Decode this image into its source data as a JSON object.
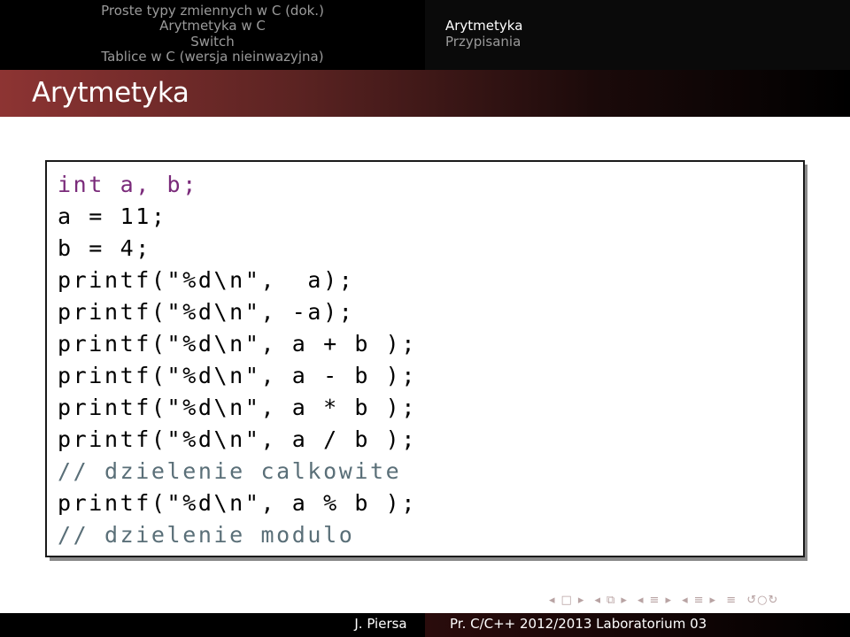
{
  "nav": {
    "left": {
      "section": "Proste typy zmiennych w C (dok.)",
      "subsections": [
        "Arytmetyka w C",
        "Switch",
        "Tablice w C (wersja nieinwazyjna)"
      ]
    },
    "right": {
      "section": "Arytmetyka",
      "subsections": [
        "Przypisania"
      ]
    }
  },
  "frame": {
    "title": "Arytmetyka"
  },
  "code": {
    "lines": [
      "int a, b;",
      "a = 11;",
      "b = 4;",
      "printf(\"%d\\n\",  a);",
      "printf(\"%d\\n\", -a);",
      "printf(\"%d\\n\", a + b );",
      "printf(\"%d\\n\", a - b );",
      "printf(\"%d\\n\", a * b );",
      "printf(\"%d\\n\", a / b );",
      "// dzielenie calkowite",
      "printf(\"%d\\n\", a % b );",
      "// dzielenie modulo"
    ],
    "colors": {
      "keyword": "#7a2a7a",
      "comment": "#5a6f78",
      "string": "#2a7f7a"
    }
  },
  "footer": {
    "author": "J. Piersa",
    "title": "Pr. C/C++ 2012/2013 Laboratorium 03"
  },
  "nav_symbols": [
    "prev-arrow",
    "slide-box",
    "next-arrow",
    "prev-arrow",
    "frame-icon",
    "next-arrow",
    "prev-arrow",
    "subsection-icon",
    "next-arrow",
    "prev-arrow",
    "section-icon",
    "next-arrow",
    "align-icon",
    "search-icon"
  ],
  "colors": {
    "accent": "#8d3433",
    "bar": "#000000"
  }
}
